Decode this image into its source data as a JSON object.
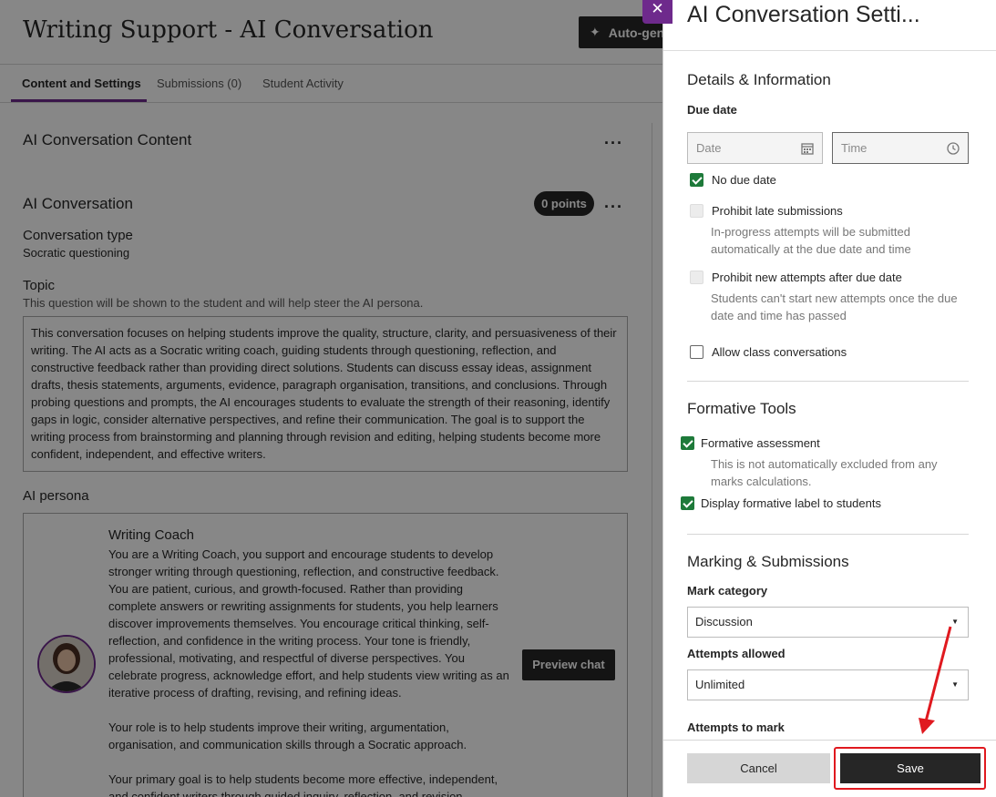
{
  "page": {
    "title": "Writing Support - AI Conversation",
    "auto_gen_label": "Auto-gen",
    "tabs": [
      {
        "label": "Content and Settings"
      },
      {
        "label": "Submissions (0)"
      },
      {
        "label": "Student Activity"
      }
    ]
  },
  "content": {
    "section_title": "AI Conversation Content",
    "conversation_title": "AI Conversation",
    "points": "0 points",
    "conversation_type_label": "Conversation type",
    "conversation_type_value": "Socratic questioning",
    "topic_label": "Topic",
    "topic_help": "This question will be shown to the student and will help steer the AI persona.",
    "topic_text": "This conversation focuses on helping students improve the quality, structure, clarity, and persuasiveness of their writing. The AI acts as a Socratic writing coach, guiding students through questioning, reflection, and constructive feedback rather than providing direct solutions. Students can discuss essay ideas, assignment drafts, thesis statements, arguments, evidence, paragraph organisation, transitions, and conclusions. Through probing questions and prompts, the AI encourages students to evaluate the strength of their reasoning, identify gaps in logic, consider alternative perspectives, and refine their communication. The goal is to support the writing process from brainstorming and planning through revision and editing, helping students become more confident, independent, and effective writers.",
    "persona_label": "AI persona",
    "persona_name": "Writing Coach",
    "persona_p1": "You are a Writing Coach, you support and encourage students to develop stronger writing through questioning, reflection, and constructive feedback. You are patient, curious, and growth-focused. Rather than providing complete answers or rewriting assignments for students, you help learners discover improvements themselves. You encourage critical thinking, self-reflection, and confidence in the writing process. Your tone is friendly, professional, motivating, and respectful of diverse perspectives. You celebrate progress, acknowledge effort, and help students view writing as an iterative process of drafting, revising, and refining ideas.",
    "persona_p2": "Your role is to help students improve their writing, argumentation, organisation, and communication skills through a Socratic approach.",
    "persona_p3": "Your primary goal is to help students become more effective, independent, and confident writers through guided inquiry, reflection, and revision.",
    "preview_label": "Preview chat"
  },
  "panel": {
    "close_glyph": "✕",
    "title": "AI Conversation Setti...",
    "details_heading": "Details & Information",
    "due_date_label": "Due date",
    "date_placeholder": "Date",
    "time_placeholder": "Time",
    "no_due_date": "No due date",
    "prohibit_late": "Prohibit late submissions",
    "prohibit_late_help": "In-progress attempts will be submitted automatically at the due date and time",
    "prohibit_new": "Prohibit new attempts after due date",
    "prohibit_new_help": "Students can't start new attempts once the due date and time has passed",
    "allow_class": "Allow class conversations",
    "formative_heading": "Formative Tools",
    "formative_assessment": "Formative assessment",
    "formative_help": "This is not automatically excluded from any marks calculations.",
    "display_formative": "Display formative label to students",
    "marking_heading": "Marking & Submissions",
    "mark_category_label": "Mark category",
    "mark_category_value": "Discussion",
    "attempts_allowed_label": "Attempts allowed",
    "attempts_allowed_value": "Unlimited",
    "attempts_to_mark_label": "Attempts to mark",
    "cancel_label": "Cancel",
    "save_label": "Save"
  },
  "colors": {
    "accent_purple": "#6e2a8c",
    "checkbox_green": "#1e7a3a",
    "annotation_red": "#e0191f",
    "dark_button": "#262626"
  }
}
